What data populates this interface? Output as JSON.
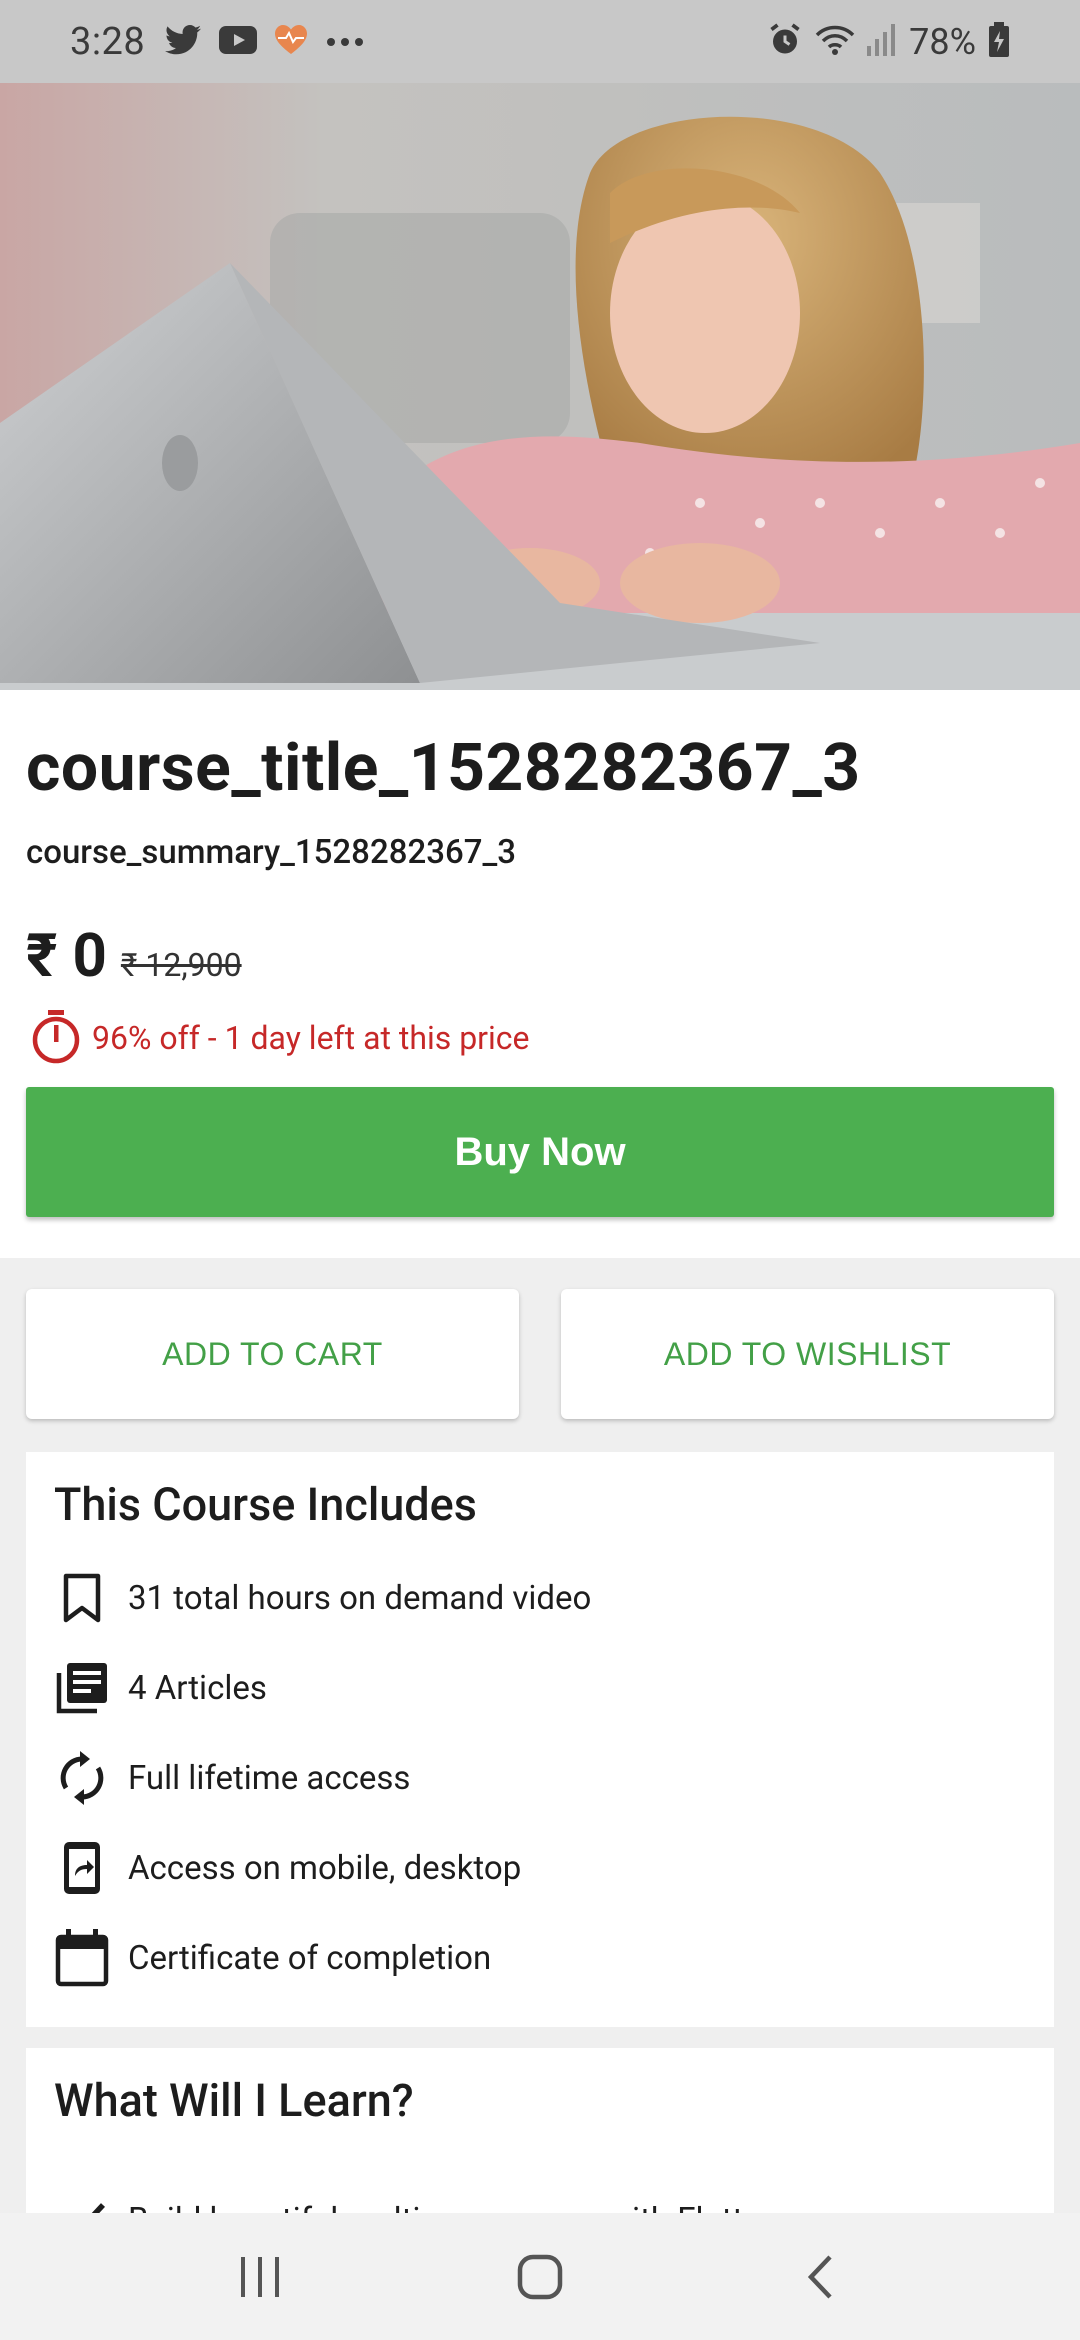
{
  "status_bar": {
    "time": "3:28",
    "battery": "78%",
    "icons_left": [
      "twitter-icon",
      "youtube-icon",
      "health-icon",
      "more-dots-icon"
    ],
    "icons_right": [
      "alarm-icon",
      "wifi-icon",
      "signal-icon",
      "battery-icon"
    ]
  },
  "course": {
    "title": "course_title_1528282367_3",
    "summary": "course_summary_1528282367_3",
    "price_current": "₹ 0",
    "price_original": "₹ 12,900",
    "offer_text": "96% off - 1 day left at this price"
  },
  "actions": {
    "buy_now": "Buy Now",
    "add_to_cart": "ADD TO CART",
    "add_to_wishlist": "ADD TO WISHLIST"
  },
  "includes": {
    "heading": "This Course Includes",
    "items": [
      {
        "icon": "bookmark-icon",
        "label": "31 total hours on demand video"
      },
      {
        "icon": "articles-icon",
        "label": "4 Articles"
      },
      {
        "icon": "sync-icon",
        "label": "Full lifetime access"
      },
      {
        "icon": "mobile-share-icon",
        "label": "Access on mobile, desktop"
      },
      {
        "icon": "calendar-icon",
        "label": "Certificate of completion"
      }
    ]
  },
  "learn": {
    "heading": "What Will I Learn?",
    "items": [
      {
        "icon": "check-icon",
        "label": "Build beautiful multiscreen apps with Flutter"
      }
    ]
  },
  "colors": {
    "accent_green": "#4caf50",
    "offer_red": "#c62828",
    "status_bar": "#c8c8c8"
  }
}
